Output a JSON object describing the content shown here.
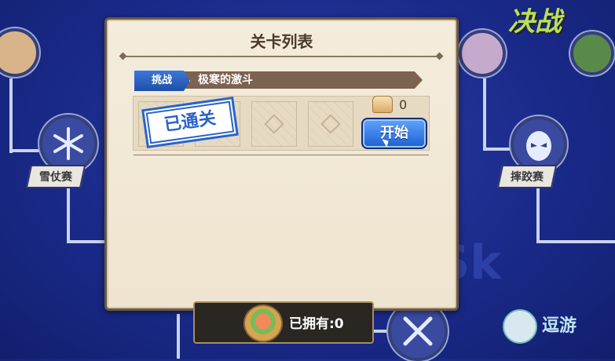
{
  "dialog": {
    "title": "关卡列表",
    "tab": {
      "chip": "挑战",
      "title": "极寒的激斗"
    },
    "stage": {
      "stamp": "已通关",
      "cost_value": "0",
      "start_label": "开始"
    }
  },
  "owned": {
    "label": "已拥有:0"
  },
  "map": {
    "node_left": "雪仗赛",
    "node_right": "摔跤赛"
  },
  "branding": {
    "top_logo": "决战",
    "watermark": "逗游"
  },
  "icons": [
    "snowflake-icon",
    "wrestler-mask-icon",
    "bread-icon",
    "dish-icon",
    "crossed-swords-icon",
    "cursor-icon"
  ]
}
